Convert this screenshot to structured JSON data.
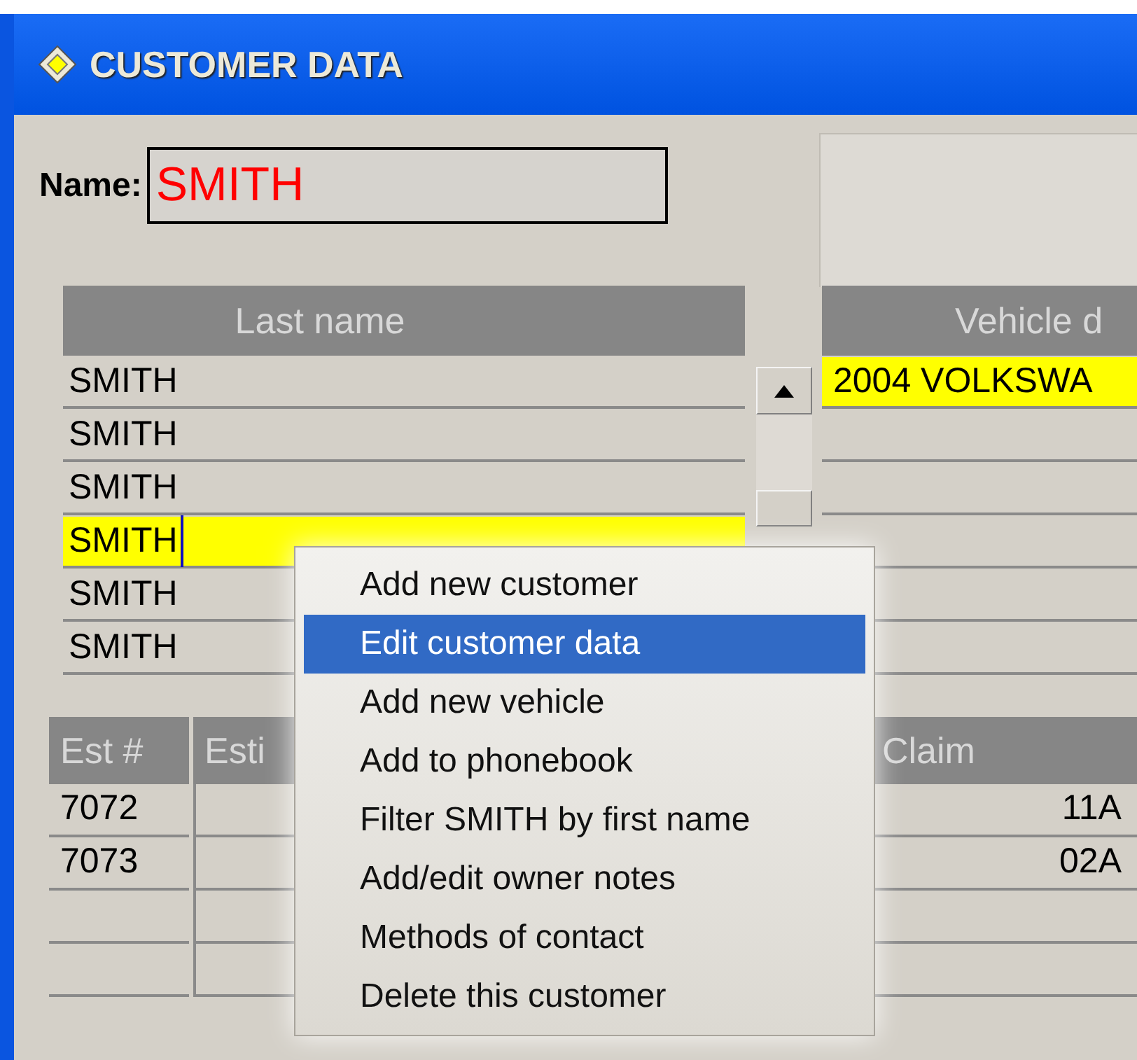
{
  "window": {
    "title": "CUSTOMER DATA"
  },
  "name_field": {
    "label": "Name:",
    "value": "SMITH"
  },
  "customers": {
    "columns": [
      "Last name"
    ],
    "rows": [
      {
        "last_name": "SMITH",
        "selected": false
      },
      {
        "last_name": "SMITH",
        "selected": false
      },
      {
        "last_name": "SMITH",
        "selected": false
      },
      {
        "last_name": "SMITH",
        "selected": true
      },
      {
        "last_name": "SMITH",
        "selected": false
      },
      {
        "last_name": "SMITH",
        "selected": false
      }
    ]
  },
  "vehicles": {
    "columns": [
      "Vehicle d"
    ],
    "rows": [
      {
        "vehicle": "2004 VOLKSWA",
        "selected": true
      }
    ]
  },
  "estimates": {
    "columns": [
      "Est #",
      "Esti",
      "",
      "Claim"
    ],
    "rows": [
      {
        "est": "7072",
        "claim": "11A"
      },
      {
        "est": "7073",
        "claim": "02A"
      }
    ]
  },
  "context_menu": {
    "items": [
      {
        "label": "Add new customer",
        "selected": false
      },
      {
        "label": "Edit customer data",
        "selected": true
      },
      {
        "label": "Add new vehicle",
        "selected": false
      },
      {
        "label": "Add to phonebook",
        "selected": false
      },
      {
        "label": "Filter SMITH by first name",
        "selected": false
      },
      {
        "label": "Add/edit owner notes",
        "selected": false
      },
      {
        "label": "Methods of contact",
        "selected": false
      },
      {
        "label": "Delete this customer",
        "selected": false
      }
    ]
  }
}
